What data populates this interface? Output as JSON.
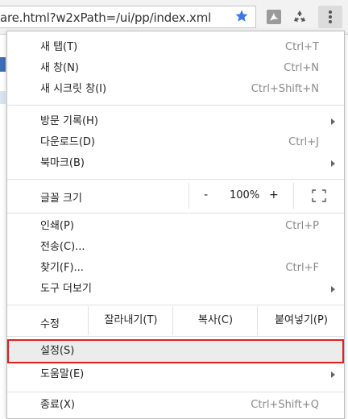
{
  "browser": {
    "url": "are.html?w2xPath=/ui/pp/index.xml",
    "icons": [
      "star-icon",
      "pdf-extension-icon",
      "recycle-extension-icon",
      "more-vert-icon"
    ],
    "accent_color": "#3b78e7"
  },
  "menu": {
    "group1": [
      {
        "label": "새 탭(T)",
        "shortcut": "Ctrl+T"
      },
      {
        "label": "새 창(N)",
        "shortcut": "Ctrl+N"
      },
      {
        "label": "새 시크릿 창(I)",
        "shortcut": "Ctrl+Shift+N"
      }
    ],
    "group2": [
      {
        "label": "방문 기록(H)",
        "submenu": true
      },
      {
        "label": "다운로드(D)",
        "shortcut": "Ctrl+J"
      },
      {
        "label": "북마크(B)",
        "submenu": true
      }
    ],
    "zoom": {
      "label": "글꼴 크기",
      "minus": "-",
      "value": "100%",
      "plus": "+"
    },
    "group3": [
      {
        "label": "인쇄(P)",
        "shortcut": "Ctrl+P"
      },
      {
        "label": "전송(C)..."
      },
      {
        "label": "찾기(F)...",
        "shortcut": "Ctrl+F"
      },
      {
        "label": "도구 더보기",
        "submenu": true
      }
    ],
    "edit": {
      "label": "수정",
      "cut": "잘라내기(T)",
      "copy": "복사(C)",
      "paste": "붙여넣기(P)"
    },
    "group4": [
      {
        "label": "설정(S)",
        "highlighted": true
      },
      {
        "label": "도움말(E)",
        "submenu": true
      }
    ],
    "group5": [
      {
        "label": "종료(X)",
        "shortcut": "Ctrl+Shift+Q"
      }
    ],
    "highlight_color": "#e0201b"
  }
}
